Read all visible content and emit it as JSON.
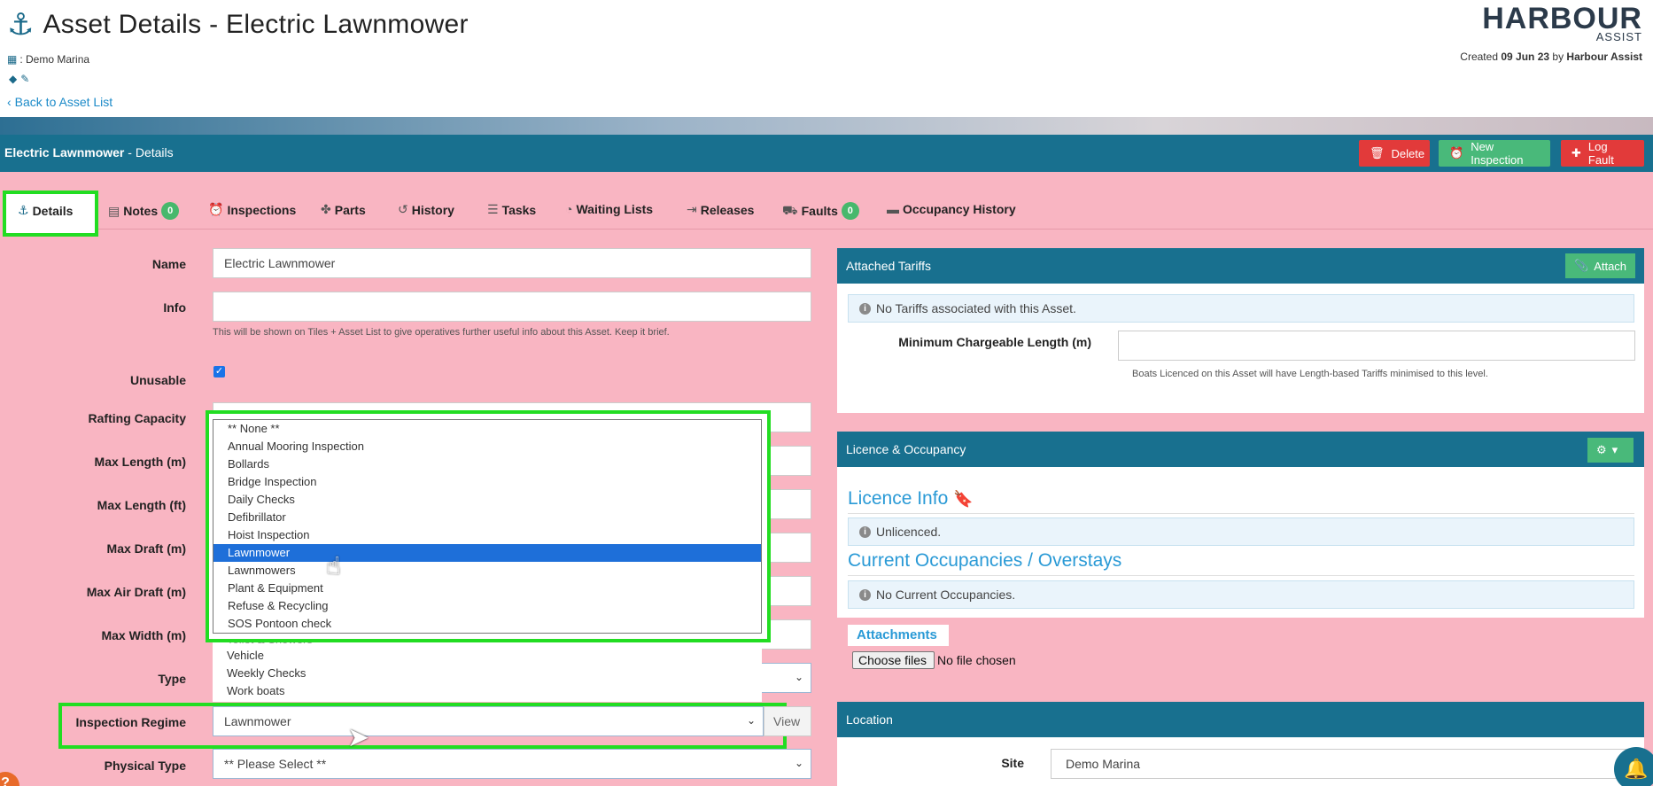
{
  "header": {
    "title": "Asset Details - Electric Lawnmower",
    "marina": ": Demo Marina",
    "back_link": "Back to Asset List",
    "logo_main": "HARBOUR",
    "logo_sub": "ASSIST",
    "created_prefix": "Created",
    "created_date": "09 Jun 23",
    "created_by_prefix": "by",
    "created_by": "Harbour Assist"
  },
  "bar": {
    "asset_name": "Electric Lawnmower",
    "suffix": " - Details",
    "delete_label": "Delete",
    "new_inspection_label": "New Inspection",
    "log_fault_label": "Log Fault"
  },
  "tabs": [
    {
      "label": "Details"
    },
    {
      "label": "Notes",
      "badge": "0"
    },
    {
      "label": "Inspections"
    },
    {
      "label": "Parts"
    },
    {
      "label": "History"
    },
    {
      "label": "Tasks"
    },
    {
      "label": "Waiting Lists"
    },
    {
      "label": "Releases"
    },
    {
      "label": "Faults",
      "badge": "0"
    },
    {
      "label": "Occupancy History"
    }
  ],
  "form": {
    "name_label": "Name",
    "name_value": "Electric Lawnmower",
    "info_label": "Info",
    "info_value": "",
    "info_hint": "This will be shown on Tiles + Asset List to give operatives further useful info about this Asset. Keep it brief.",
    "unusable_label": "Unusable",
    "unusable_checked": true,
    "rafting_label": "Rafting Capacity",
    "max_length_m_label": "Max Length (m)",
    "max_length_ft_label": "Max Length (ft)",
    "max_draft_label": "Max Draft (m)",
    "max_air_draft_label": "Max Air Draft (m)",
    "max_width_label": "Max Width (m)",
    "type_label": "Type",
    "regime_label": "Inspection Regime",
    "regime_value": "Lawnmower",
    "view_label": "View",
    "physical_type_label": "Physical Type",
    "physical_type_value": "** Please Select **"
  },
  "dropdown": {
    "options": [
      "** None **",
      "Annual Mooring Inspection",
      "Bollards",
      "Bridge Inspection",
      "Daily Checks",
      "Defibrillator",
      "Hoist Inspection",
      "Lawnmower",
      "Lawnmowers",
      "Plant & Equipment",
      "Refuse & Recycling",
      "SOS Pontoon check"
    ],
    "selected": "Lawnmower",
    "lower_options": [
      "Toilet & Showers",
      "Vehicle",
      "Weekly Checks",
      "Work boats"
    ]
  },
  "tariffs": {
    "title": "Attached Tariffs",
    "attach_label": "Attach",
    "empty_msg": "No Tariffs associated with this Asset.",
    "min_len_label": "Minimum Chargeable Length (m)",
    "min_len_value": "",
    "min_len_hint": "Boats Licenced on this Asset will have Length-based Tariffs minimised to this level."
  },
  "licence": {
    "title": "Licence & Occupancy",
    "info_title": "Licence Info",
    "info_msg": "Unlicenced.",
    "occ_title": "Current Occupancies / Overstays",
    "occ_msg": "No Current Occupancies."
  },
  "attachments": {
    "title": "Attachments",
    "choose_label": "Choose files",
    "status": "No file chosen"
  },
  "location": {
    "title": "Location",
    "site_label": "Site",
    "site_value": "Demo Marina"
  },
  "colors": {
    "teal": "#18708f",
    "pink": "#f9b5c2",
    "green": "#49b97a",
    "red": "#e23a3a",
    "highlight": "#22dd22"
  }
}
